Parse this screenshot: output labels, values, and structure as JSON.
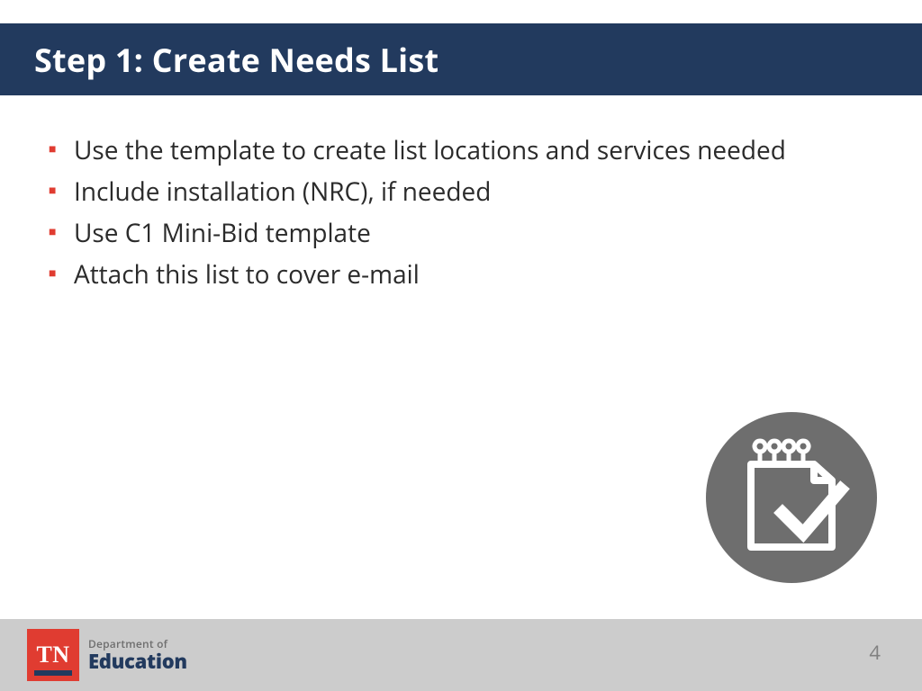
{
  "title": "Step 1: Create Needs List",
  "bullets": [
    "Use the template to create list locations and services needed",
    "Include installation (NRC), if needed",
    "Use C1 Mini-Bid template",
    "Attach this list to cover e-mail"
  ],
  "footer": {
    "tn": "TN",
    "dept_small": "Department of",
    "dept_big": "Education",
    "page": "4"
  },
  "colors": {
    "header_bg": "#223A5E",
    "bullet": "#E03C31",
    "footer_bg": "#CCCCCC",
    "tn_bg": "#E03C31",
    "graphic_bg": "#6E6E6E"
  }
}
